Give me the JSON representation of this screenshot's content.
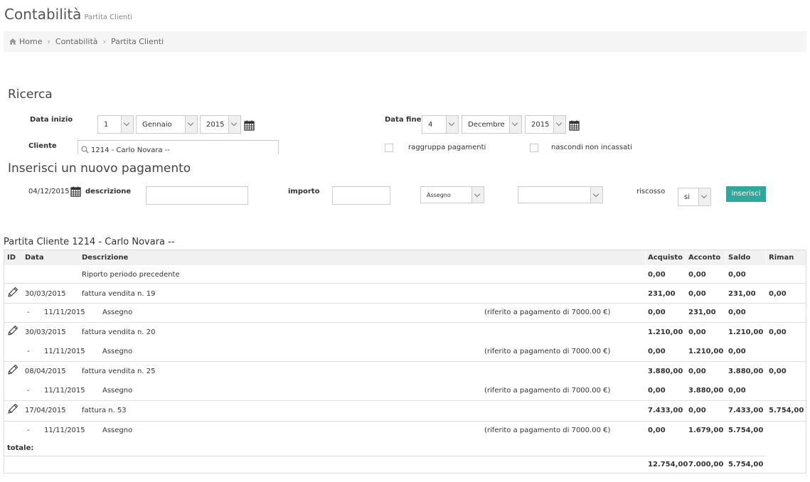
{
  "header": {
    "title": "Contabilità",
    "subtitle": "Partita Clienti"
  },
  "breadcrumb": {
    "home": "Home",
    "items": [
      "Contabilità",
      "Partita Clienti"
    ]
  },
  "search": {
    "title": "Ricerca",
    "start_label": "Data inizio",
    "start_day": "1",
    "start_month": "Gennaio",
    "start_year": "2015",
    "end_label": "Data fine",
    "end_day": "4",
    "end_month": "Decembre",
    "end_year": "2015",
    "client_label": "Cliente",
    "client_value": "1214 - Carlo Novara --",
    "group_payments": "raggruppa pagamenti",
    "hide_uncollected": "nascondi non incassati"
  },
  "new_payment": {
    "title": "Inserisci un nuovo pagamento",
    "date": "04/12/2015",
    "description_label": "descrizione",
    "amount_label": "importo",
    "method": "Assegno",
    "collected_label": "riscosso",
    "collected_value": "si",
    "insert_button": "inserisci"
  },
  "ledger": {
    "title": "Partita Cliente 1214 - Carlo Novara --",
    "columns": [
      "ID",
      "Data",
      "Descrizione",
      "Acquisto",
      "Acconto",
      "Saldo",
      "Riman"
    ],
    "carry_over": {
      "description": "Riporto periodo precedente",
      "acquisto": "0,00",
      "acconto": "0,00",
      "saldo": "0,00"
    },
    "invoices": [
      {
        "date": "30/03/2015",
        "description": "fattura vendita n. 19",
        "acquisto": "231,00",
        "acconto": "0,00",
        "saldo": "231,00",
        "riman": "0,00",
        "payment": {
          "dash": "-",
          "date": "11/11/2015",
          "method": "Assegno",
          "ref": "(riferito a pagamento di 7000.00 €)",
          "acquisto": "0,00",
          "acconto": "231,00",
          "saldo": "0,00"
        }
      },
      {
        "date": "30/03/2015",
        "description": "fattura vendita n. 20",
        "acquisto": "1.210,00",
        "acconto": "0,00",
        "saldo": "1.210,00",
        "riman": "0,00",
        "payment": {
          "dash": "-",
          "date": "11/11/2015",
          "method": "Assegno",
          "ref": "(riferito a pagamento di 7000.00 €)",
          "acquisto": "0,00",
          "acconto": "1.210,00",
          "saldo": "0,00"
        }
      },
      {
        "date": "08/04/2015",
        "description": "fattura vendita n. 25",
        "acquisto": "3.880,00",
        "acconto": "0,00",
        "saldo": "3.880,00",
        "riman": "0,00",
        "payment": {
          "dash": "-",
          "date": "11/11/2015",
          "method": "Assegno",
          "ref": "(riferito a pagamento di 7000.00 €)",
          "acquisto": "0,00",
          "acconto": "3.880,00",
          "saldo": "0,00"
        }
      },
      {
        "date": "17/04/2015",
        "description": "fattura n. 53",
        "acquisto": "7.433,00",
        "acconto": "0,00",
        "saldo": "7.433,00",
        "riman": "5.754,00",
        "payment": {
          "dash": "-",
          "date": "11/11/2015",
          "method": "Assegno",
          "ref": "(riferito a pagamento di 7000.00 €)",
          "acquisto": "0,00",
          "acconto": "1.679,00",
          "saldo": "5.754,00"
        }
      }
    ],
    "total_label": "totale:",
    "totals": {
      "acquisto": "12.754,00",
      "acconto": "7.000,00",
      "saldo": "5.754,00"
    }
  }
}
